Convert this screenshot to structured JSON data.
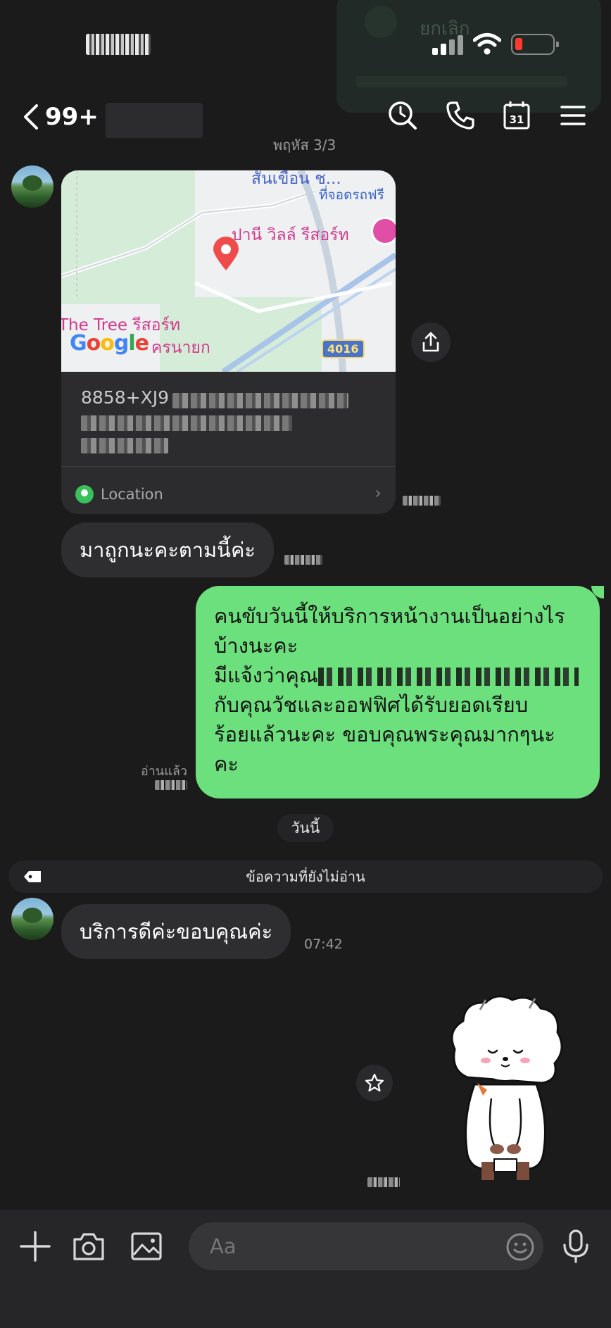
{
  "status_bar": {
    "time": "17:41"
  },
  "call_overlay": {
    "label": "ยกเลิก"
  },
  "header": {
    "unread_count": "99+"
  },
  "date_separator": "พฤหัส 3/3",
  "location_card": {
    "map_labels": {
      "place1": "สันเขื่อน ช...",
      "parking": "ที่จอดรถฟรี",
      "resort": "ปานี วิลล์ รีสอร์ท",
      "tree": "The Tree รีสอร์ท",
      "nakhon": "ครนายก",
      "road": "4016",
      "google": "Google"
    },
    "address_code": "8858+XJ9",
    "footer_label": "Location"
  },
  "messages": {
    "in1": "มาถูกนะคะตามนี้ค่ะ",
    "out1_lines": [
      "คนขับวันนี้ให้บริการหน้างานเป็นอย่างไร",
      "บ้างนะคะ",
      "มีแจ้งว่าคุณ",
      "กับคุณวัชและออฟฟิศได้รับยอดเรียบ",
      "ร้อยแล้วนะคะ ขอบคุณพระคุณมากๆนะ",
      "คะ"
    ],
    "read_label": "อ่านแล้ว",
    "today": "วันนี้",
    "unread_banner": "ข้อความที่ยังไม่อ่าน",
    "in2": "บริการดีค่ะขอบคุณค่ะ",
    "in2_time": "07:42"
  },
  "composer": {
    "placeholder": "Aa"
  },
  "colors": {
    "bg": "#1b1b1c",
    "bubble_in": "#2e2e30",
    "bubble_out": "#6ce07d",
    "accent_green": "#3ac05a"
  }
}
